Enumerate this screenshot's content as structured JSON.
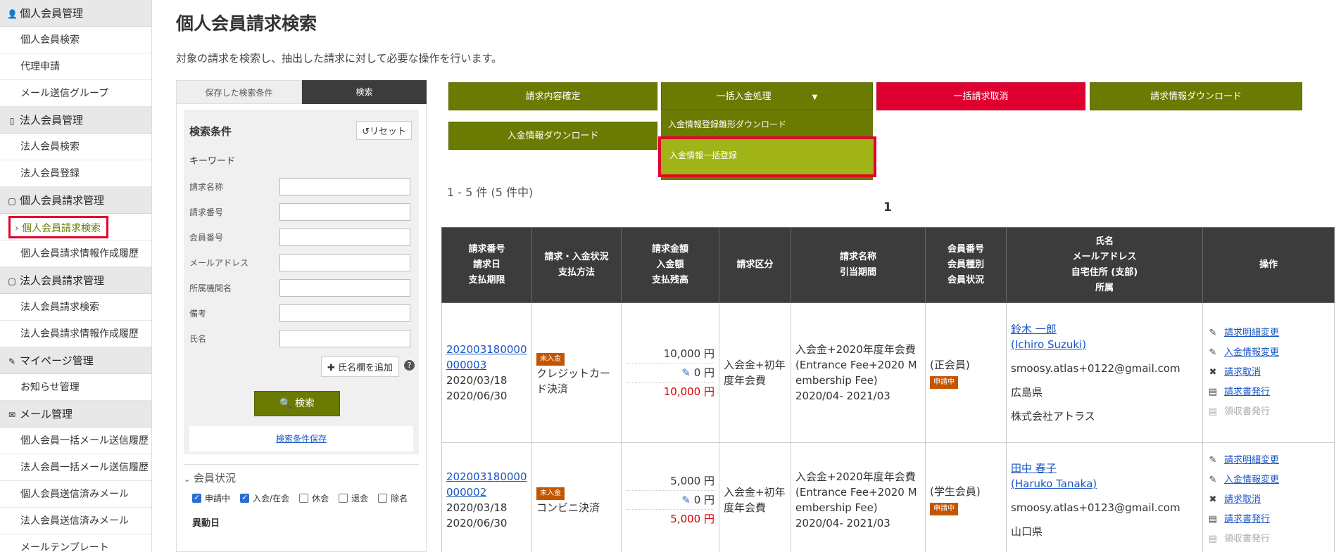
{
  "sidebar": {
    "sections": [
      {
        "title": "個人会員管理",
        "icon": "person-icon",
        "items": [
          "個人会員検索",
          "代理申請",
          "メール送信グループ"
        ]
      },
      {
        "title": "法人会員管理",
        "icon": "building-icon",
        "items": [
          "法人会員検索",
          "法人会員登録"
        ]
      },
      {
        "title": "個人会員請求管理",
        "icon": "document-icon",
        "items": [
          "個人会員請求検索",
          "個人会員請求情報作成履歴"
        ]
      },
      {
        "title": "法人会員請求管理",
        "icon": "document-icon",
        "items": [
          "法人会員請求検索",
          "法人会員請求情報作成履歴"
        ]
      },
      {
        "title": "マイページ管理",
        "icon": "pin-icon",
        "items": [
          "お知らせ管理"
        ]
      },
      {
        "title": "メール管理",
        "icon": "envelope-icon",
        "items": [
          "個人会員一括メール送信履歴",
          "法人会員一括メール送信履歴",
          "個人会員送信済みメール",
          "法人会員送信済みメール",
          "メールテンプレート"
        ]
      }
    ],
    "active_item": "個人会員請求検索"
  },
  "page": {
    "title": "個人会員請求検索",
    "description": "対象の請求を検索し、抽出した請求に対して必要な操作を行います。"
  },
  "search_panel": {
    "tabs": [
      "保存した検索条件",
      "検索"
    ],
    "condition_title": "検索条件",
    "reset_label": "リセット",
    "keyword_label": "キーワード",
    "fields": [
      "請求名称",
      "請求番号",
      "会員番号",
      "メールアドレス",
      "所属機関名",
      "備考",
      "氏名"
    ],
    "add_name_label": "氏名欄を追加",
    "search_label": "検索",
    "save_label": "検索条件保存",
    "member_status_title": "会員状況",
    "statuses": [
      {
        "label": "申請中",
        "checked": true
      },
      {
        "label": "入会/在会",
        "checked": true
      },
      {
        "label": "休会",
        "checked": false
      },
      {
        "label": "退会",
        "checked": false
      },
      {
        "label": "除名",
        "checked": false
      }
    ],
    "change_date_label": "異動日"
  },
  "actions": {
    "confirm": "請求内容確定",
    "bulk_payment": "一括入金処理",
    "bulk_cancel": "一括請求取消",
    "download_billing": "請求情報ダウンロード",
    "download_payment": "入金情報ダウンロード",
    "dropdown": [
      "入金情報登録雛形ダウンロード",
      "入金情報一括登録"
    ]
  },
  "results": {
    "count_text": "1 - 5 件 (5 件中)",
    "page": "1",
    "headers": [
      "請求番号\n請求日\n支払期限",
      "請求・入金状況\n支払方法",
      "請求金額\n入金額\n支払残高",
      "請求区分",
      "請求名称\n引当期間",
      "会員番号\n会員種別\n会員状況",
      "氏名\nメールアドレス\n自宅住所 (支部)\n所属",
      "操作"
    ],
    "rows": [
      {
        "id": "202003180000000003",
        "id_line1": "202003180000",
        "id_line2": "000003",
        "date": "2020/03/18",
        "due": "2020/06/30",
        "status": "未入金",
        "method": "クレジットカード決済",
        "billed": "10,000 円",
        "paid": "0 円",
        "balance": "10,000 円",
        "category": "入会金+初年度年会費",
        "name_title": "入会金+2020年度年会費(Entrance Fee+2020 Membership Fee)",
        "period": "2020/04- 2021/03",
        "member_type": "(正会員)",
        "member_status": "申請中",
        "name": "鈴木 一郎",
        "name_en": "(Ichiro Suzuki)",
        "email": "smoosy.atlas+0122@gmail.com",
        "address": "広島県",
        "org": "株式会社アトラス"
      },
      {
        "id": "202003180000000002",
        "id_line1": "202003180000",
        "id_line2": "000002",
        "date": "2020/03/18",
        "due": "2020/06/30",
        "status": "未入金",
        "method": "コンビニ決済",
        "billed": "5,000 円",
        "paid": "0 円",
        "balance": "5,000 円",
        "category": "入会金+初年度年会費",
        "name_title": "入会金+2020年度年会費(Entrance Fee+2020 Membership Fee)",
        "period": "2020/04- 2021/03",
        "member_type": "(学生会員)",
        "member_status": "申請中",
        "name": "田中 春子",
        "name_en": "(Haruko Tanaka)",
        "email": "smoosy.atlas+0123@gmail.com",
        "address": "山口県",
        "org": ""
      }
    ],
    "ops": [
      "請求明細変更",
      "入金情報変更",
      "請求取消",
      "請求書発行",
      "領収書発行"
    ]
  },
  "colors": {
    "accent": "#6b7a00",
    "danger": "#df0030",
    "highlight": "#e4002b"
  }
}
